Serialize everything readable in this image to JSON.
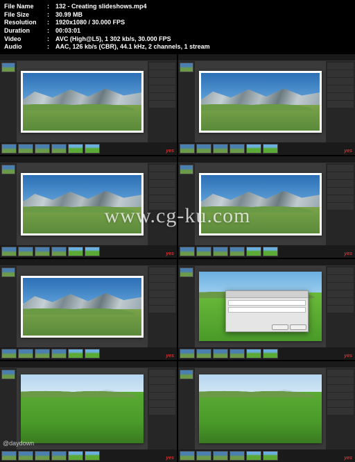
{
  "file_info": {
    "filename_label": "File Name",
    "filename": "132 - Creating slideshows.mp4",
    "filesize_label": "File Size",
    "filesize": "30.99 MB",
    "resolution_label": "Resolution",
    "resolution": "1920x1080 / 30.000 FPS",
    "duration_label": "Duration",
    "duration": "00:03:01",
    "video_label": "Video",
    "video": "AVC (High@L5), 1 302 kb/s, 30.000 FPS",
    "audio_label": "Audio",
    "audio": "AAC, 126 kb/s (CBR), 44.1 kHz, 2 channels, 1 stream"
  },
  "watermark": "www.cg-ku.com",
  "daydown": "@daydown",
  "brand": "yes",
  "separator": ":",
  "thumbnails": [
    {
      "scene": "mountain",
      "frame": true,
      "dialog": false
    },
    {
      "scene": "mountain",
      "frame": true,
      "dialog": false
    },
    {
      "scene": "mountain",
      "frame": true,
      "dialog": false
    },
    {
      "scene": "mountain",
      "frame": true,
      "dialog": false
    },
    {
      "scene": "mountain",
      "frame": true,
      "dialog": false
    },
    {
      "scene": "green",
      "frame": false,
      "dialog": true
    },
    {
      "scene": "hills2",
      "frame": false,
      "dialog": false
    },
    {
      "scene": "hills2",
      "frame": false,
      "dialog": false
    }
  ]
}
